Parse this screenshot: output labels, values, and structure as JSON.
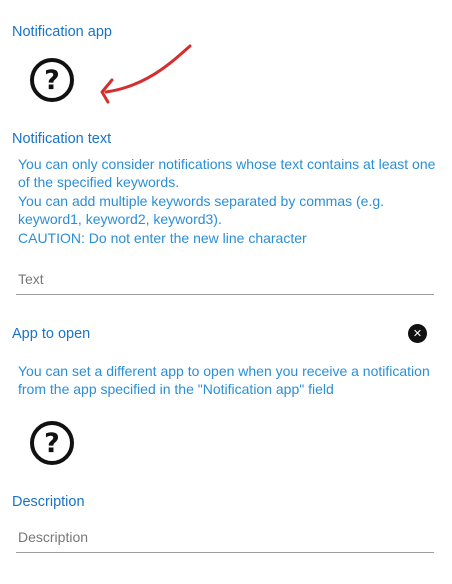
{
  "notification_app": {
    "title": "Notification app",
    "icon": "help-circle-icon",
    "icon_glyph": "?"
  },
  "annotation": {
    "icon": "red-arrow-annotation",
    "color": "#d32f2f"
  },
  "notification_text": {
    "title": "Notification text",
    "help": "You can only consider notifications whose text contains at least one of the specified keywords.\nYou can add multiple keywords separated by commas (e.g. keyword1, keyword2, keyword3).\nCAUTION: Do not enter the new line character",
    "placeholder": "Text",
    "value": ""
  },
  "app_to_open": {
    "title": "App to open",
    "clear_icon": "close-circle-icon",
    "clear_glyph": "✕",
    "help": "You can set a different app to open when you receive a notification from the app specified in the \"Notification app\" field",
    "icon": "help-circle-icon",
    "icon_glyph": "?"
  },
  "description": {
    "title": "Description",
    "placeholder": "Description",
    "value": ""
  },
  "colors": {
    "accent": "#1a73c8",
    "help_text": "#2a8fd6",
    "underline": "#9e9e9e",
    "annotation": "#d32f2f"
  }
}
